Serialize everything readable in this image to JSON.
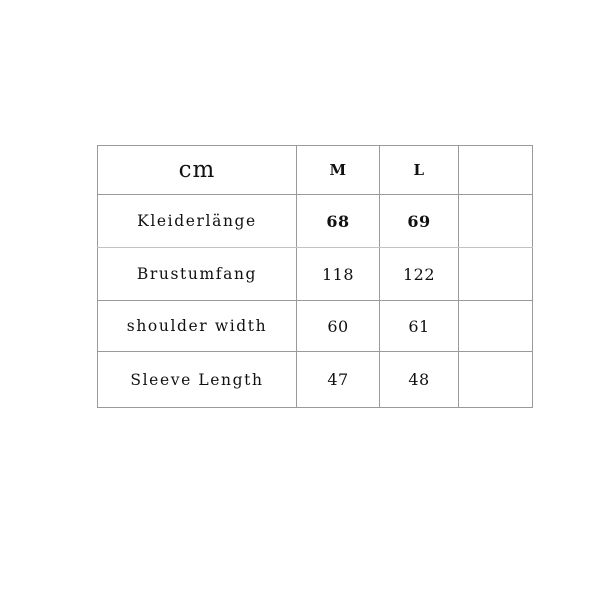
{
  "table": {
    "unit_label": "cm",
    "columns": [
      {
        "key": "label",
        "header": "cm"
      },
      {
        "key": "m",
        "header": "M"
      },
      {
        "key": "l",
        "header": "L"
      },
      {
        "key": "blank",
        "header": ""
      }
    ],
    "rows": [
      {
        "label": "Kleiderlänge",
        "m": "68",
        "l": "69",
        "blank": "",
        "bold_values": true
      },
      {
        "label": "Brustumfang",
        "m": "118",
        "l": "122",
        "blank": "",
        "bold_values": false
      },
      {
        "label": "shoulder width",
        "m": "60",
        "l": "61",
        "blank": "",
        "bold_values": false
      },
      {
        "label": "Sleeve Length",
        "m": "47",
        "l": "48",
        "blank": "",
        "bold_values": false
      }
    ],
    "colors": {
      "background": "#ffffff",
      "border": "#9a9a9a",
      "border_light": "#c2c2c2",
      "text": "#111111"
    }
  }
}
